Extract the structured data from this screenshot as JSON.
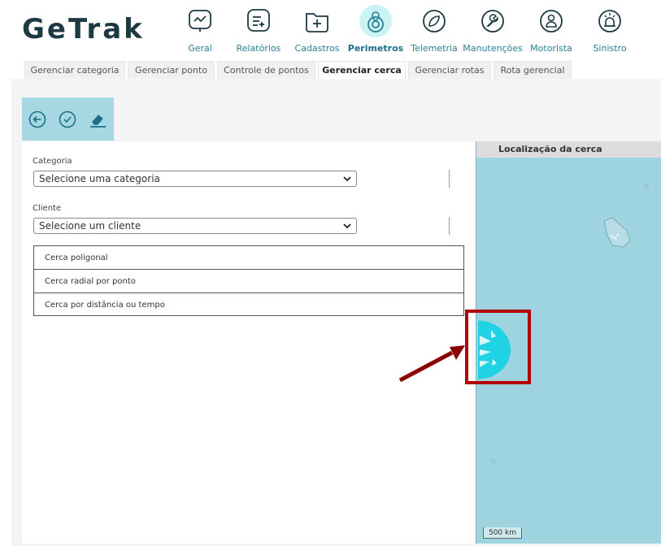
{
  "brand": {
    "logo_text": "GeTrak"
  },
  "nav": {
    "items": [
      {
        "label": "Geral",
        "icon": "chart-line-icon"
      },
      {
        "label": "Relatórios",
        "icon": "list-add-icon"
      },
      {
        "label": "Cadastros",
        "icon": "folder-plus-icon"
      },
      {
        "label": "Perimetros",
        "icon": "location-pin-icon",
        "active": true
      },
      {
        "label": "Telemetria",
        "icon": "leaf-icon"
      },
      {
        "label": "Manutenções",
        "icon": "wrench-icon"
      },
      {
        "label": "Motorista",
        "icon": "person-icon"
      },
      {
        "label": "Sinistro",
        "icon": "alarm-icon"
      }
    ]
  },
  "tabs": {
    "items": [
      {
        "label": "Gerenciar categoria"
      },
      {
        "label": "Gerenciar ponto"
      },
      {
        "label": "Controle de pontos"
      },
      {
        "label": "Gerenciar cerca",
        "active": true
      },
      {
        "label": "Gerenciar rotas"
      },
      {
        "label": "Rota gerencial"
      }
    ]
  },
  "toolbar": {
    "back_icon": "arrow-left-icon",
    "confirm_icon": "check-icon",
    "clear_icon": "eraser-icon"
  },
  "form": {
    "category_label": "Categoria",
    "category_value": "Selecione uma categoria",
    "client_label": "Cliente",
    "client_value": "Selecione um cliente",
    "options": [
      {
        "label": "Cerca poligonal"
      },
      {
        "label": "Cerca radial por ponto"
      },
      {
        "label": "Cerca por distância ou tempo"
      }
    ]
  },
  "map": {
    "title": "Localização da cerca",
    "scale": "500 km"
  },
  "colors": {
    "brand_dark": "#1d3a43",
    "accent": "#2a7d93",
    "toolbar_bg": "#a5d8e3",
    "map_water": "#9ed4df",
    "highlight_cyan": "#1fd2e4",
    "annotation_red": "#b30000"
  }
}
